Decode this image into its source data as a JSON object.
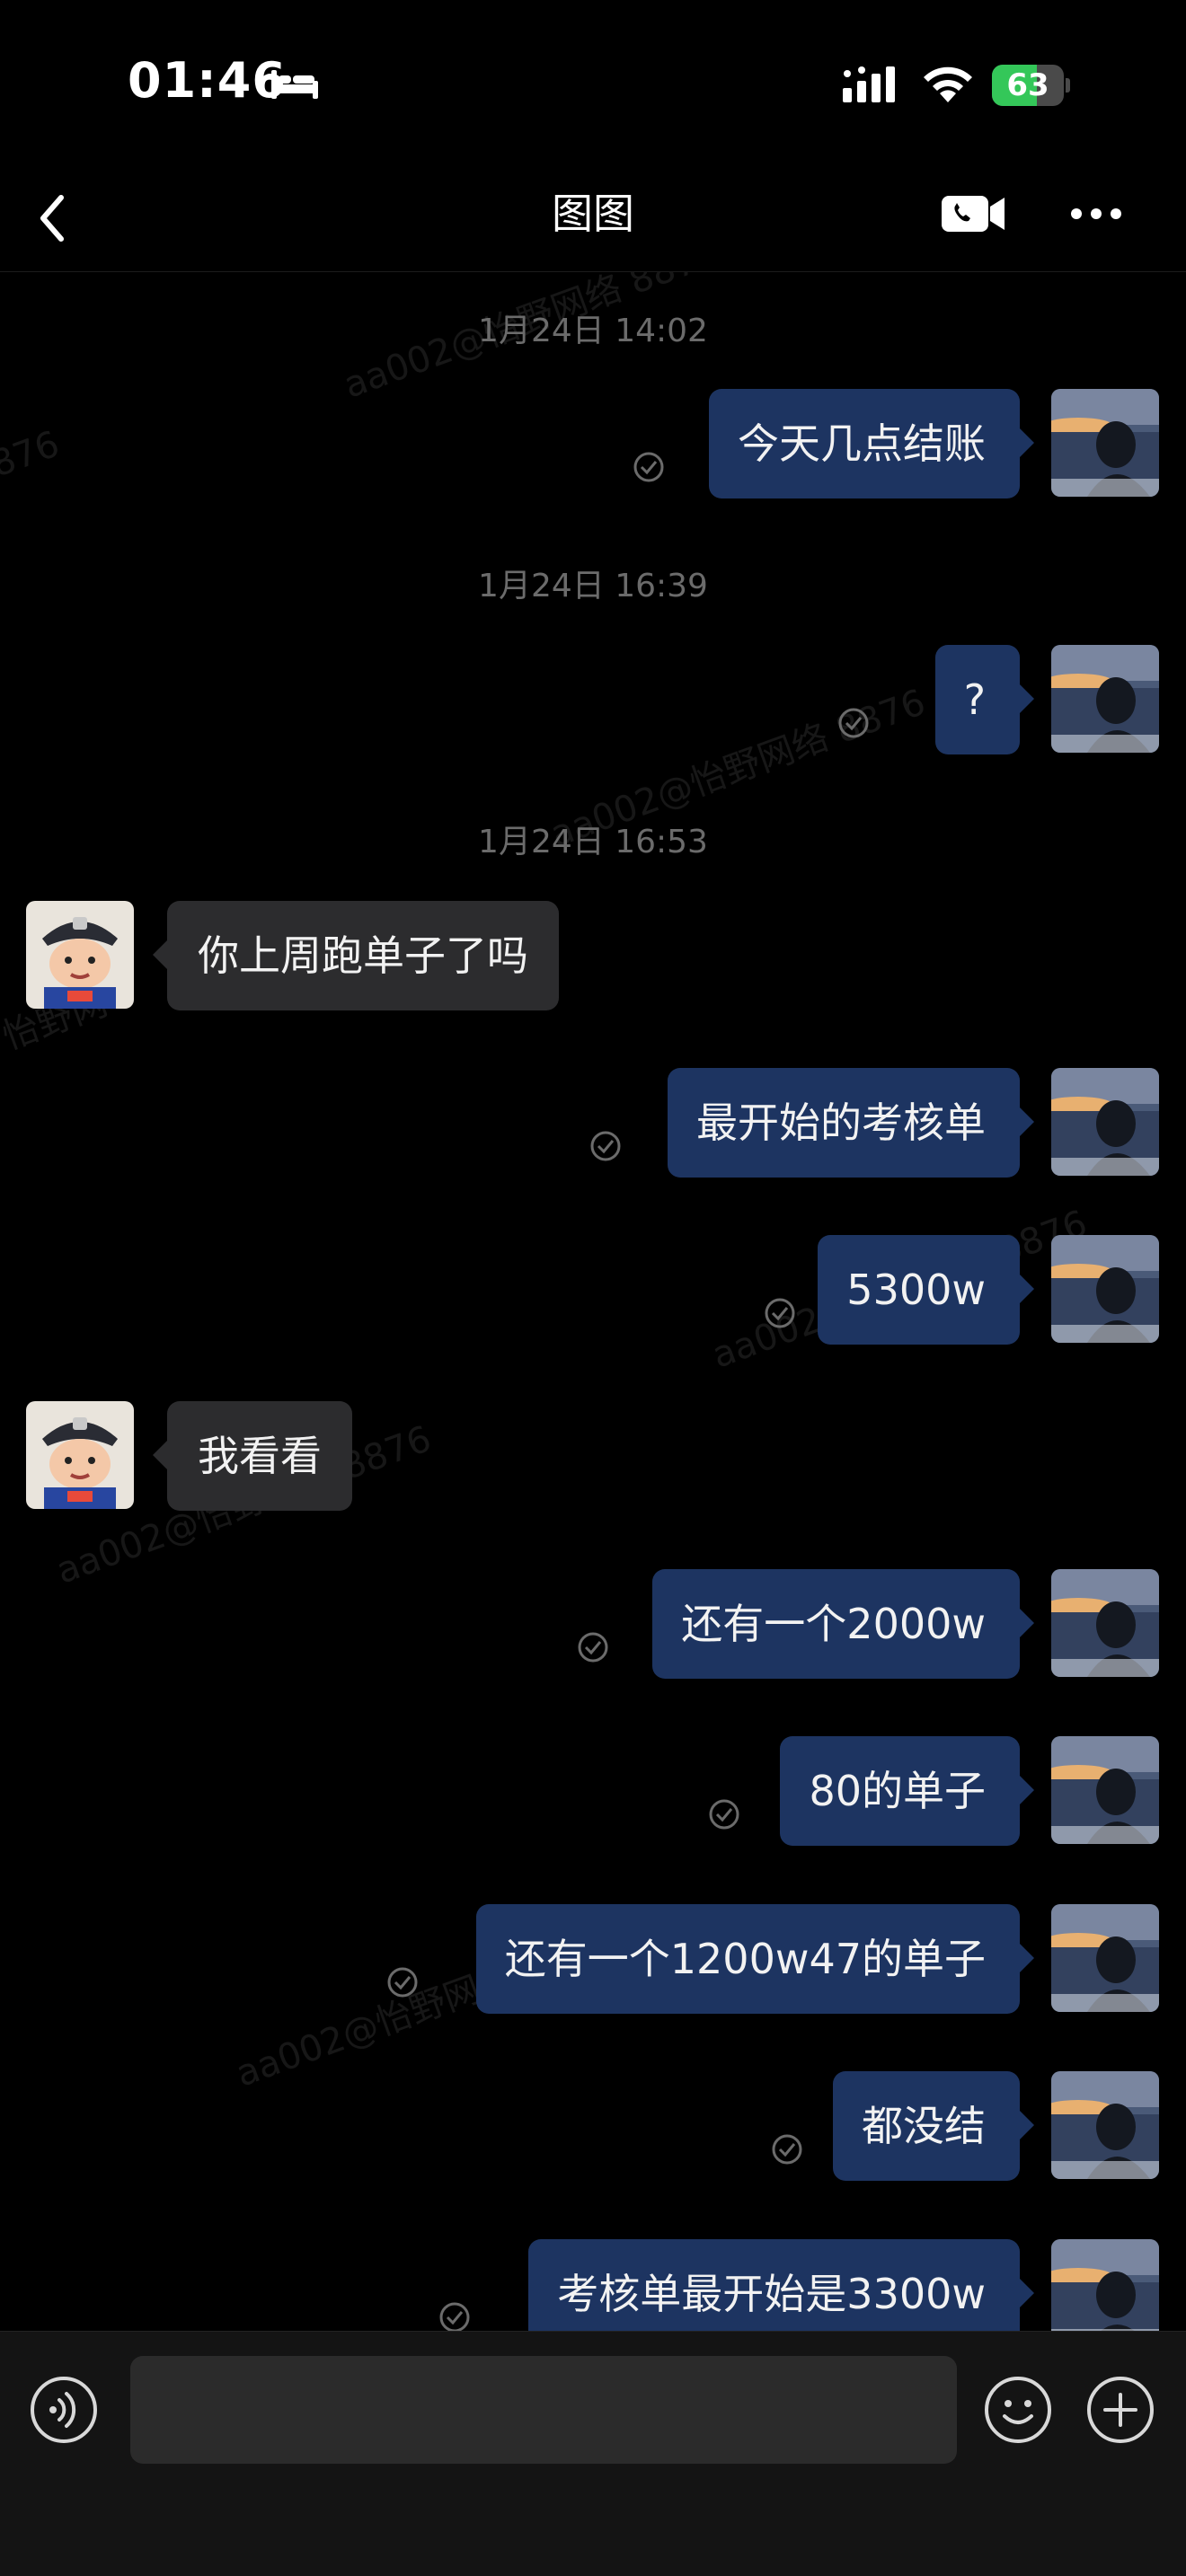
{
  "status_bar": {
    "time": "01:46",
    "battery_percent": "63",
    "battery_level": 0.63,
    "icons": [
      "bed-icon",
      "signal-icon",
      "wifi-icon",
      "battery-charging-icon"
    ]
  },
  "header": {
    "title": "图图",
    "icons": [
      "back-icon",
      "video-call-icon",
      "more-icon"
    ]
  },
  "timestamps": [
    "1月24日 14:02",
    "1月24日 16:39",
    "1月24日 16:53"
  ],
  "messages": [
    {
      "sender": "me",
      "text": "今天几点结账"
    },
    {
      "sender": "me",
      "text": "?"
    },
    {
      "sender": "other",
      "text": "你上周跑单子了吗"
    },
    {
      "sender": "me",
      "text": "最开始的考核单"
    },
    {
      "sender": "me",
      "text": "5300w"
    },
    {
      "sender": "other",
      "text": "我看看"
    },
    {
      "sender": "me",
      "text": "还有一个2000w"
    },
    {
      "sender": "me",
      "text": "80的单子"
    },
    {
      "sender": "me",
      "text": "还有一个1200w47的单子"
    },
    {
      "sender": "me",
      "text": "都没结"
    },
    {
      "sender": "me",
      "text": "考核单最开始是3300w"
    }
  ],
  "watermarks": [
    "aa002@怡野网络 8876",
    "876",
    "aa002@怡野网络 8876",
    "怡野网",
    "aa002@怡野网络 8876",
    "aa002@怡野网络 8876",
    "aa002@怡野网络 8876"
  ],
  "input_bar": {
    "placeholder": "",
    "icons": [
      "voice-icon",
      "emoji-icon",
      "plus-icon"
    ]
  },
  "colors": {
    "background": "#000000",
    "my_bubble": "#1d3461",
    "other_bubble": "#2c2c2e",
    "timestamp": "#6b6b6b",
    "battery_green": "#34c759"
  }
}
